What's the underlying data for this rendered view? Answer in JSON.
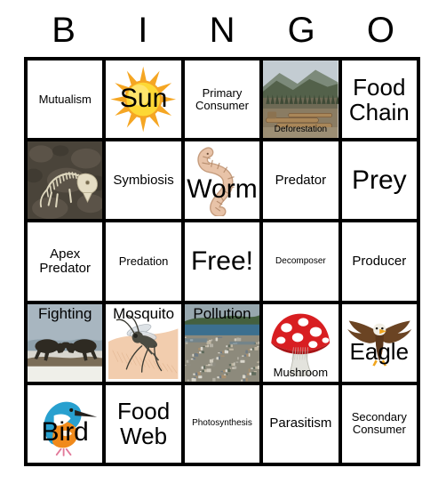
{
  "card": {
    "title": "BINGO",
    "header_letters": [
      "B",
      "I",
      "N",
      "G",
      "O"
    ],
    "rows": 5,
    "columns": 5,
    "border_color": "#000000",
    "background_color": "#ffffff",
    "free_space": "Free!"
  },
  "cells": [
    {
      "id": "b1",
      "column": "B",
      "row": 1,
      "text": "Mutualism",
      "art": "none",
      "text_size": "sm",
      "text_pos": "middle"
    },
    {
      "id": "i1",
      "column": "I",
      "row": 1,
      "text": "Sun",
      "art": "sun",
      "text_size": "xxl",
      "text_pos": "middle"
    },
    {
      "id": "n1",
      "column": "N",
      "row": 1,
      "text": "Primary Consumer",
      "art": "none",
      "text_size": "sm",
      "text_pos": "middle"
    },
    {
      "id": "g1",
      "column": "G",
      "row": 1,
      "text": "Deforestation",
      "art": "deforestation",
      "text_size": "xs",
      "text_pos": "bottom"
    },
    {
      "id": "o1",
      "column": "O",
      "row": 1,
      "text": "Food Chain",
      "art": "none",
      "text_size": "xl",
      "text_pos": "middle"
    },
    {
      "id": "b2",
      "column": "B",
      "row": 2,
      "text": "",
      "art": "fossil",
      "text_size": "sm",
      "text_pos": "middle"
    },
    {
      "id": "i2",
      "column": "I",
      "row": 2,
      "text": "Symbiosis",
      "art": "none",
      "text_size": "md",
      "text_pos": "middle"
    },
    {
      "id": "n2",
      "column": "N",
      "row": 2,
      "text": "Worm",
      "art": "worm",
      "text_size": "xxl",
      "text_pos": "lower"
    },
    {
      "id": "g2",
      "column": "G",
      "row": 2,
      "text": "Predator",
      "art": "none",
      "text_size": "md",
      "text_pos": "middle"
    },
    {
      "id": "o2",
      "column": "O",
      "row": 2,
      "text": "Prey",
      "art": "none",
      "text_size": "xxl",
      "text_pos": "middle"
    },
    {
      "id": "b3",
      "column": "B",
      "row": 3,
      "text": "Apex Predator",
      "art": "none",
      "text_size": "md",
      "text_pos": "middle"
    },
    {
      "id": "i3",
      "column": "I",
      "row": 3,
      "text": "Predation",
      "art": "none",
      "text_size": "sm",
      "text_pos": "middle"
    },
    {
      "id": "n3",
      "column": "N",
      "row": 3,
      "text": "Free!",
      "art": "none",
      "text_size": "xxl",
      "text_pos": "middle"
    },
    {
      "id": "g3",
      "column": "G",
      "row": 3,
      "text": "Decomposer",
      "art": "none",
      "text_size": "xs",
      "text_pos": "middle"
    },
    {
      "id": "o3",
      "column": "O",
      "row": 3,
      "text": "Producer",
      "art": "none",
      "text_size": "md",
      "text_pos": "middle"
    },
    {
      "id": "b4",
      "column": "B",
      "row": 4,
      "text": "Fighting",
      "art": "rams",
      "text_size": "lg",
      "text_pos": "top"
    },
    {
      "id": "i4",
      "column": "I",
      "row": 4,
      "text": "Mosquito",
      "art": "mosquito",
      "text_size": "lg",
      "text_pos": "top"
    },
    {
      "id": "n4",
      "column": "N",
      "row": 4,
      "text": "Pollution",
      "art": "pollution",
      "text_size": "lg",
      "text_pos": "top"
    },
    {
      "id": "g4",
      "column": "G",
      "row": 4,
      "text": "Mushroom",
      "art": "mushroom",
      "text_size": "sm",
      "text_pos": "bottom"
    },
    {
      "id": "o4",
      "column": "O",
      "row": 4,
      "text": "Eagle",
      "art": "eagle",
      "text_size": "xl",
      "text_pos": "lower"
    },
    {
      "id": "b5",
      "column": "B",
      "row": 5,
      "text": "Bird",
      "art": "kingfisher",
      "text_size": "xxl",
      "text_pos": "lower"
    },
    {
      "id": "i5",
      "column": "I",
      "row": 5,
      "text": "Food Web",
      "art": "none",
      "text_size": "xl",
      "text_pos": "middle"
    },
    {
      "id": "n5",
      "column": "N",
      "row": 5,
      "text": "Photosynthesis",
      "art": "none",
      "text_size": "xs",
      "text_pos": "middle"
    },
    {
      "id": "g5",
      "column": "G",
      "row": 5,
      "text": "Parasitism",
      "art": "none",
      "text_size": "md",
      "text_pos": "middle"
    },
    {
      "id": "o5",
      "column": "O",
      "row": 5,
      "text": "Secondary Consumer",
      "art": "none",
      "text_size": "sm",
      "text_pos": "middle"
    }
  ],
  "palette": {
    "sun_outer": "#f5a623",
    "sun_inner": "#fdd835",
    "worm_body": "#e8c3a8",
    "mushroom_cap": "#d81e21",
    "mushroom_spot": "#ffffff",
    "mushroom_stem": "#e3e3dd",
    "eagle_body": "#6b4423",
    "kingfisher_blue": "#28a0cf",
    "kingfisher_orange": "#f08a1b",
    "pollution_water": "#3b6f8f",
    "forest_green": "#4a5c3a",
    "fossil_soil": "#4a443a",
    "rams_sky": "#9fb0bb"
  }
}
